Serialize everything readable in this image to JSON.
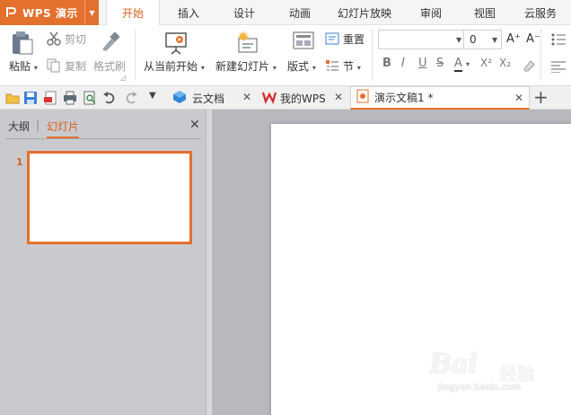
{
  "app": {
    "title": "WPS 演示",
    "brand_color": "#e3702d"
  },
  "menu": {
    "tabs": [
      "开始",
      "插入",
      "设计",
      "动画",
      "幻灯片放映",
      "审阅",
      "视图",
      "云服务"
    ],
    "active_tab": "开始"
  },
  "ribbon": {
    "paste": "粘贴",
    "cut": "剪切",
    "copy": "复制",
    "format_painter": "格式刷",
    "from_current": "从当前开始",
    "new_slide": "新建幻灯片",
    "layout": "版式",
    "reset": "重置",
    "section": "节",
    "font_size": "0",
    "font_name": "",
    "grow_font": "A⁺",
    "shrink_font": "A⁻",
    "bold": "B",
    "italic": "I",
    "underline": "U",
    "shadow": "S",
    "strike": "abc",
    "font_color": "A",
    "superscript": "X²",
    "subscript": "X₂"
  },
  "doc_tabs": [
    {
      "label": "云文档",
      "icon": "cloud-doc-icon"
    },
    {
      "label": "我的WPS",
      "icon": "wps-logo-icon"
    },
    {
      "label": "演示文稿1 *",
      "icon": "presentation-file-icon",
      "active": true
    }
  ],
  "left_panel": {
    "tab_outline": "大纲",
    "tab_slides": "幻灯片",
    "separator": "|",
    "active_tab": "幻灯片",
    "slides": [
      {
        "number": "1",
        "selected": true
      }
    ]
  },
  "watermark": {
    "brand": "Bai",
    "suffix": "经验",
    "url": "jingyan.baidu.com"
  }
}
